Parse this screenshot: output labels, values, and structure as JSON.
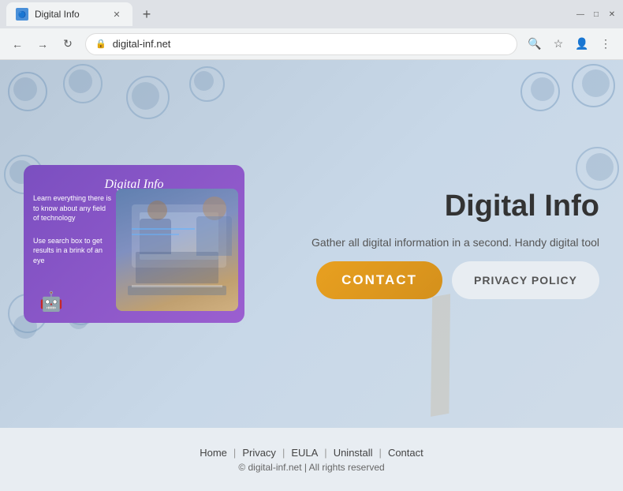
{
  "browser": {
    "tab_title": "Digital Info",
    "tab_favicon_text": "DI",
    "new_tab_label": "+",
    "address": "digital-inf.net",
    "window_minimize": "—",
    "window_maximize": "□",
    "window_close": "✕"
  },
  "website": {
    "title": "Digital Info",
    "subtitle": "Gather all digital information in a second. Handy digital tool",
    "promo_card": {
      "title": "Digital Info",
      "text1": "Learn everything there is to know about any field of technology",
      "text2": "Use search box to get results in a brink of an eye"
    },
    "buttons": {
      "contact_label": "CONTACT",
      "privacy_label": "PRIVACY POLICY"
    },
    "footer": {
      "nav_items": [
        "Home",
        "Privacy",
        "EULA",
        "Uninstall",
        "Contact"
      ],
      "copyright": "© digital-inf.net | All rights reserved"
    }
  }
}
